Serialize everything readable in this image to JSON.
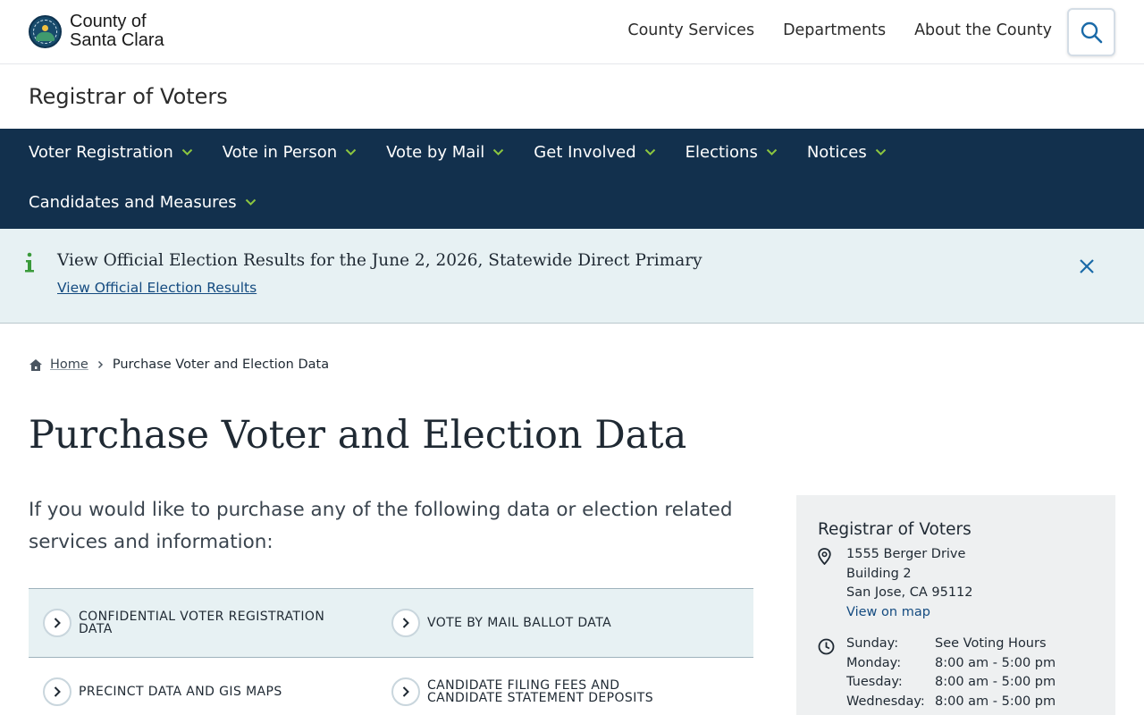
{
  "header": {
    "county_line1": "County of",
    "county_line2": "Santa Clara",
    "nav": [
      "County Services",
      "Departments",
      "About the County"
    ]
  },
  "department": "Registrar of Voters",
  "main_nav": {
    "row1": [
      "Voter Registration",
      "Vote in Person",
      "Vote by Mail",
      "Get Involved",
      "Elections",
      "Notices"
    ],
    "row2": [
      "Candidates and Measures"
    ]
  },
  "alert": {
    "title": "View Official Election Results for the June 2, 2026, Statewide Direct Primary",
    "link": "View Official Election Results"
  },
  "breadcrumb": {
    "home": "Home",
    "current": "Purchase Voter and Election Data"
  },
  "page_title": "Purchase Voter and Election Data",
  "intro": "If you would like to purchase any of the following data or election related services and information:",
  "services": [
    [
      "Confidential Voter Registration Data",
      "Vote by Mail Ballot Data"
    ],
    [
      "Precinct Data and GIS Maps",
      "Candidate Filing Fees and Candidate Statement Deposits"
    ]
  ],
  "sidebar": {
    "title": "Registrar of Voters",
    "address": [
      "1555 Berger Drive",
      "Building 2",
      "San Jose, CA 95112"
    ],
    "map_link": "View on map",
    "hours": [
      {
        "day": "Sunday:",
        "time": "See Voting Hours"
      },
      {
        "day": "Monday:",
        "time": "8:00 am - 5:00 pm"
      },
      {
        "day": "Tuesday:",
        "time": "8:00 am - 5:00 pm"
      },
      {
        "day": "Wednesday:",
        "time": "8:00 am - 5:00 pm"
      }
    ]
  },
  "colors": {
    "nav_bg": "#12304d",
    "chevron_accent": "#8cc63f",
    "alert_bg": "#e7f1f3",
    "link": "#144b80"
  },
  "icons": {
    "logo": "county-seal-icon",
    "search": "search-icon",
    "alert": "info-icon",
    "close": "close-icon",
    "home": "home-icon",
    "service": "chevron-right-icon",
    "address": "location-pin-icon",
    "hours": "clock-icon"
  }
}
